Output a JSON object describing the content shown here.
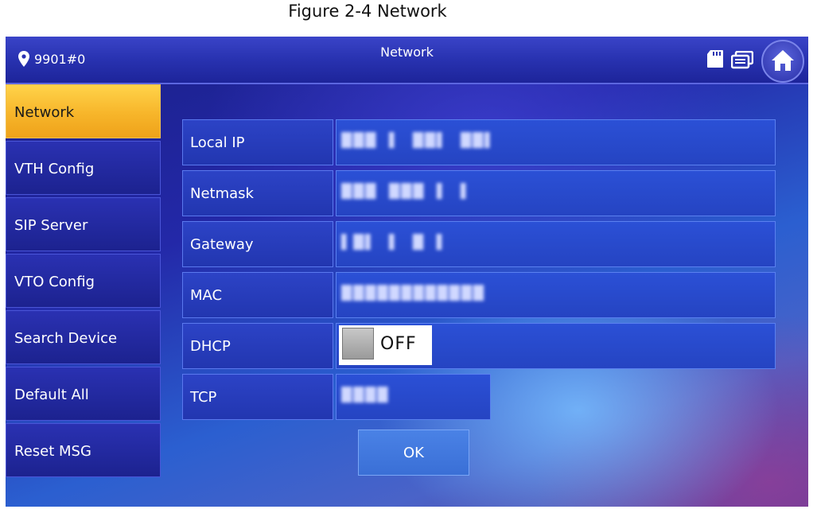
{
  "caption": "Figure 2-4 Network",
  "header": {
    "device_id": "9901#0",
    "title": "Network",
    "icons": [
      "location-pin-icon",
      "sd-card-icon",
      "monitor-icon",
      "home-icon"
    ]
  },
  "sidebar": {
    "items": [
      {
        "label": "Network",
        "active": true
      },
      {
        "label": "VTH Config",
        "active": false
      },
      {
        "label": "SIP Server",
        "active": false
      },
      {
        "label": "VTO Config",
        "active": false
      },
      {
        "label": "Search Device",
        "active": false
      },
      {
        "label": "Default All",
        "active": false
      },
      {
        "label": "Reset MSG",
        "active": false
      }
    ]
  },
  "form": {
    "local_ip_label": "Local IP",
    "netmask_label": "Netmask",
    "gateway_label": "Gateway",
    "mac_label": "MAC",
    "dhcp_label": "DHCP",
    "dhcp_state": "OFF",
    "tcp_label": "TCP"
  },
  "actions": {
    "ok_label": "OK"
  },
  "colors": {
    "active_tab": "#f7b52a",
    "background": "#2328a8"
  }
}
